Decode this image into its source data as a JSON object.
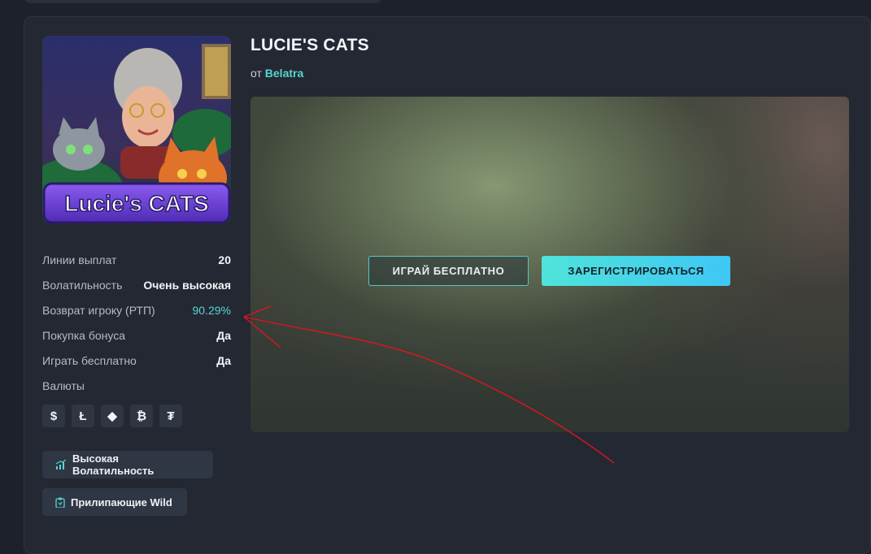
{
  "game": {
    "title": "LUCIE'S CATS",
    "provider_prefix": "от",
    "provider": "Belatra",
    "thumbnail_text": "Lucie's CATS"
  },
  "actions": {
    "play_free": "ИГРАЙ БЕСПЛАТНО",
    "register": "ЗАРЕГИСТРИРОВАТЬСЯ"
  },
  "stats": [
    {
      "label": "Линии выплат",
      "value": "20"
    },
    {
      "label": "Волатильность",
      "value": "Очень высокая"
    },
    {
      "label": "Возврат игроку (РТП)",
      "value": "90.29%"
    },
    {
      "label": "Покупка бонуса",
      "value": "Да"
    },
    {
      "label": "Играть бесплатно",
      "value": "Да"
    }
  ],
  "currencies_label": "Валюты",
  "currencies": [
    {
      "icon": "dollar-icon",
      "glyph": "$"
    },
    {
      "icon": "litecoin-icon",
      "glyph": "Ł"
    },
    {
      "icon": "ethereum-icon",
      "glyph": "◆"
    },
    {
      "icon": "bitcoin-icon",
      "glyph": "₿"
    },
    {
      "icon": "tether-icon",
      "glyph": "₮"
    }
  ],
  "tags": [
    {
      "icon": "chart-icon",
      "label": "Высокая Волатильность"
    },
    {
      "icon": "clipboard-icon",
      "label": "Прилипающие Wild"
    }
  ],
  "colors": {
    "accent": "#55d6d0",
    "annotation": "#e0141e",
    "background": "#1d212a",
    "card": "#242833"
  }
}
